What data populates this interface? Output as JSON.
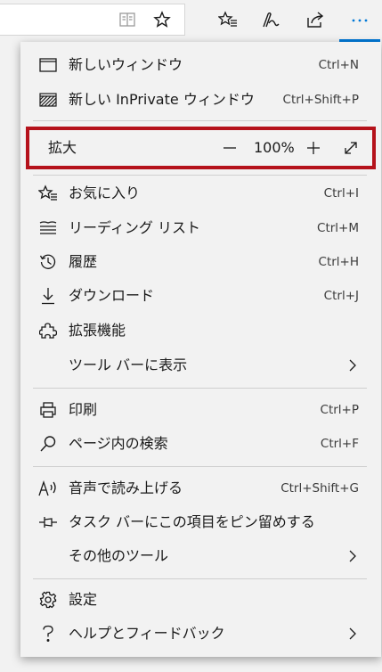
{
  "toolbar": {
    "icons": [
      "reading-view-icon",
      "favorite-star-icon",
      "favorites-hub-icon",
      "pen-icon",
      "share-icon",
      "more-icon"
    ]
  },
  "menu": {
    "new_window": {
      "label": "新しいウィンドウ",
      "shortcut": "Ctrl+N"
    },
    "new_inprivate": {
      "label": "新しい InPrivate ウィンドウ",
      "shortcut": "Ctrl+Shift+P"
    },
    "zoom": {
      "label": "拡大",
      "value": "100%"
    },
    "favorites": {
      "label": "お気に入り",
      "shortcut": "Ctrl+I"
    },
    "reading_list": {
      "label": "リーディング リスト",
      "shortcut": "Ctrl+M"
    },
    "history": {
      "label": "履歴",
      "shortcut": "Ctrl+H"
    },
    "downloads": {
      "label": "ダウンロード",
      "shortcut": "Ctrl+J"
    },
    "extensions": {
      "label": "拡張機能"
    },
    "show_in_toolbar": {
      "label": "ツール バーに表示"
    },
    "print": {
      "label": "印刷",
      "shortcut": "Ctrl+P"
    },
    "find_on_page": {
      "label": "ページ内の検索",
      "shortcut": "Ctrl+F"
    },
    "read_aloud": {
      "label": "音声で読み上げる",
      "shortcut": "Ctrl+Shift+G"
    },
    "pin_taskbar": {
      "label": "タスク バーにこの項目をピン留めする"
    },
    "more_tools": {
      "label": "その他のツール"
    },
    "settings": {
      "label": "設定"
    },
    "help": {
      "label": "ヘルプとフィードバック"
    }
  },
  "colors": {
    "highlight_border": "#b5121b",
    "accent": "#0078d7"
  }
}
